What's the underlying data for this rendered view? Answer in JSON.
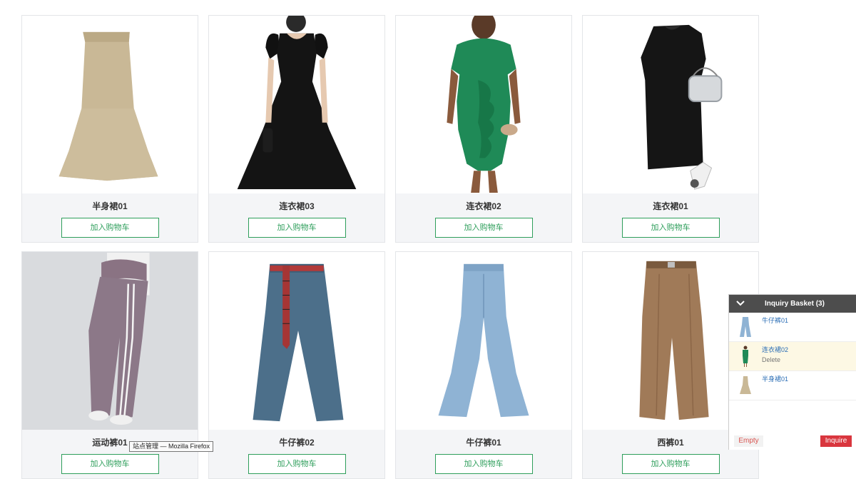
{
  "products": [
    {
      "name": "半身裙01",
      "button": "加入购物车",
      "image": "beige-skirt"
    },
    {
      "name": "连衣裙03",
      "button": "加入购物车",
      "image": "black-dress"
    },
    {
      "name": "连衣裙02",
      "button": "加入购物车",
      "image": "green-dress"
    },
    {
      "name": "连衣裙01",
      "button": "加入购物车",
      "image": "black-shift-dress"
    },
    {
      "name": "运动裤01",
      "button": "加入购物车",
      "image": "purple-track-pants"
    },
    {
      "name": "牛仔裤02",
      "button": "加入购物车",
      "image": "dark-jeans"
    },
    {
      "name": "牛仔裤01",
      "button": "加入购物车",
      "image": "light-flare-jeans"
    },
    {
      "name": "西裤01",
      "button": "加入购物车",
      "image": "brown-trousers"
    }
  ],
  "tooltip": "站点管理 — Mozilla Firefox",
  "basket": {
    "title": "Inquiry Basket (3)",
    "items": [
      {
        "name": "牛仔裤01",
        "image": "light-flare-jeans"
      },
      {
        "name": "连衣裙02",
        "delete": "Delete",
        "image": "green-dress"
      },
      {
        "name": "半身裙01",
        "image": "beige-skirt"
      }
    ],
    "empty_label": "Empty",
    "inquire_label": "Inquire"
  },
  "colors": {
    "accent_green": "#2e9e5b",
    "inquire_red": "#d9363e",
    "basket_header": "#4d4d4d",
    "link_blue": "#2a6db5"
  }
}
